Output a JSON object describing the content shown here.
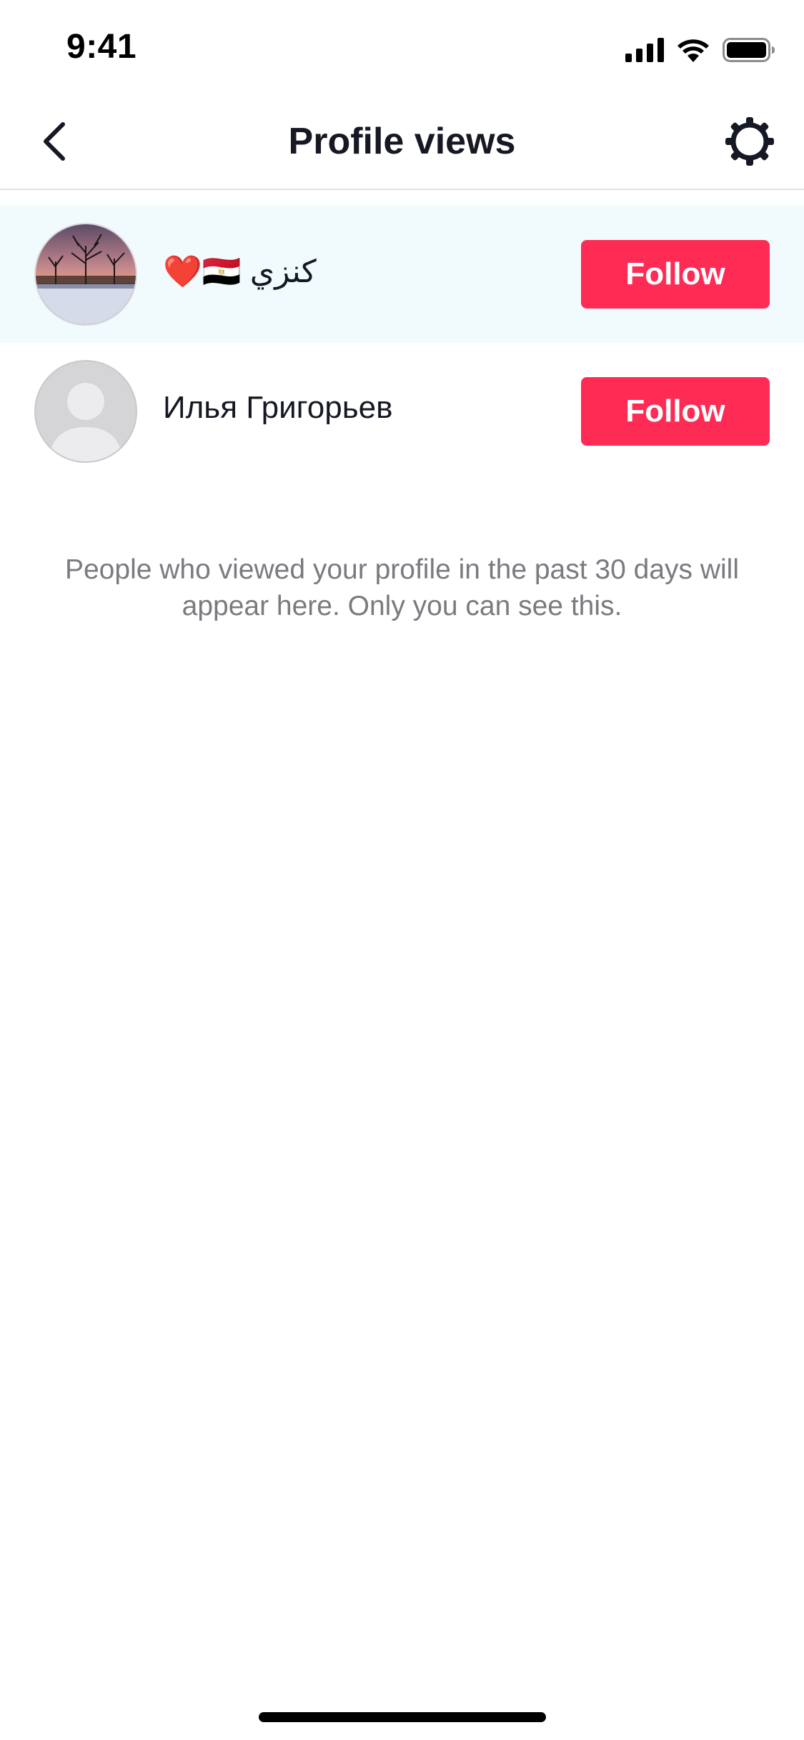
{
  "status_bar": {
    "time": "9:41"
  },
  "header": {
    "title": "Profile views",
    "back_icon": "chevron-left-icon",
    "settings_icon": "gear-icon"
  },
  "viewers": [
    {
      "name": "❤️🇪🇬 كنزي",
      "avatar": "photo-winter-trees",
      "follow_label": "Follow",
      "highlighted": true
    },
    {
      "name": "Илья Григорьев",
      "avatar": "default-avatar",
      "follow_label": "Follow",
      "highlighted": false
    }
  ],
  "info_text": "People who viewed your profile in the past 30 days will appear here. Only you can see this.",
  "colors": {
    "accent": "#fe2c55",
    "highlight_row": "#f1fbfd",
    "muted_text": "#7a7a80"
  }
}
